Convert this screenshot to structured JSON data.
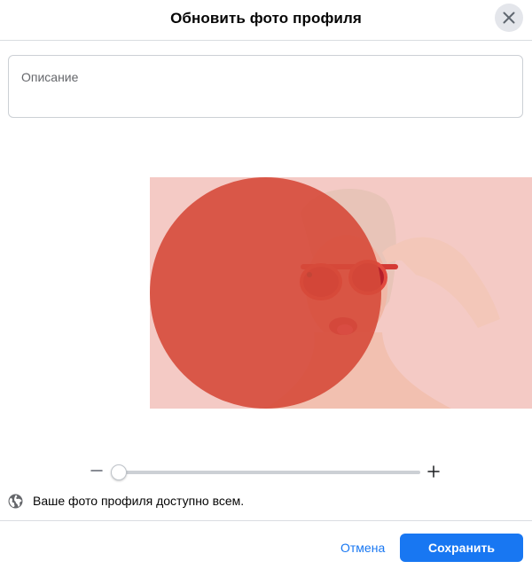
{
  "header": {
    "title": "Обновить фото профиля",
    "close_icon": "close-icon"
  },
  "description": {
    "placeholder": "Описание",
    "value": ""
  },
  "photo": {
    "description": "Woman with pink hair wearing red sunglasses on a pink background",
    "background_color": "#f4cac5",
    "circle_color": "#d64a3a"
  },
  "zoom": {
    "minus_icon": "minus-icon",
    "plus_icon": "plus-icon",
    "level": 0.02
  },
  "privacy": {
    "icon": "globe-icon",
    "text": "Ваше фото профиля доступно всем."
  },
  "footer": {
    "cancel_label": "Отмена",
    "save_label": "Сохранить"
  },
  "colors": {
    "accent": "#1877f2",
    "text": "#050505",
    "secondary_text": "#65676b",
    "divider": "#dadde1"
  }
}
